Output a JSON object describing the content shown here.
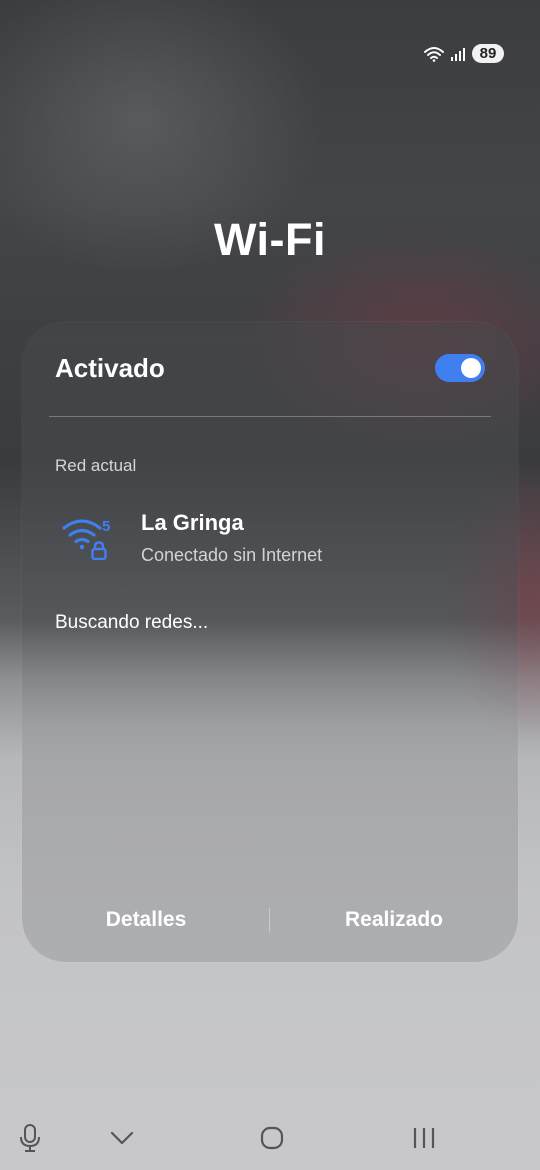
{
  "status_bar": {
    "battery_level": "89",
    "icons": [
      "wifi-icon",
      "signal-icon",
      "battery-icon"
    ]
  },
  "header": {
    "title": "Wi-Fi"
  },
  "panel": {
    "toggle_label": "Activado",
    "toggle_on": true,
    "section_label": "Red actual",
    "current_network": {
      "name": "La Gringa",
      "status": "Conectado sin Internet",
      "icon": "wifi-5ghz-lock-icon",
      "band": "5"
    },
    "scan_status": "Buscando redes...",
    "buttons": {
      "details": "Detalles",
      "done": "Realizado"
    }
  },
  "nav_bar": {
    "items": [
      "mic-icon",
      "chevron-down-icon",
      "home-icon",
      "recents-icon"
    ]
  },
  "colors": {
    "accent": "#3f7ff0",
    "text": "#ffffff"
  }
}
